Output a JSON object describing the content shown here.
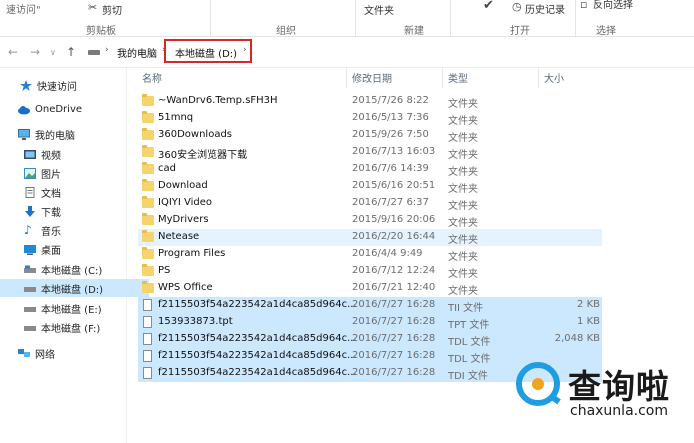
{
  "ribbon": {
    "copy_path": "速访问\"",
    "cut": "剪切",
    "clipboard_group": "剪贴板",
    "organize_group": "组织",
    "folder_label": "文件夹",
    "new_group": "新建",
    "open_group": "打开",
    "history": "历史记录",
    "invert_selection": "反向选择",
    "select_group": "选择"
  },
  "address": {
    "crumbs": [
      "我的电脑",
      "本地磁盘 (D:)"
    ],
    "separator": "›"
  },
  "sidebar": {
    "items": [
      {
        "label": "快速访问",
        "icon": "star-icon"
      },
      {
        "label": "OneDrive",
        "icon": "cloud-icon"
      },
      {
        "label": "我的电脑",
        "icon": "computer-icon"
      },
      {
        "label": "视频",
        "icon": "video-icon"
      },
      {
        "label": "图片",
        "icon": "picture-icon"
      },
      {
        "label": "文档",
        "icon": "document-icon"
      },
      {
        "label": "下载",
        "icon": "download-icon"
      },
      {
        "label": "音乐",
        "icon": "music-icon"
      },
      {
        "label": "桌面",
        "icon": "desktop-icon"
      },
      {
        "label": "本地磁盘 (C:)",
        "icon": "drive-icon"
      },
      {
        "label": "本地磁盘 (D:)",
        "icon": "drive-icon"
      },
      {
        "label": "本地磁盘 (E:)",
        "icon": "drive-icon"
      },
      {
        "label": "本地磁盘 (F:)",
        "icon": "drive-icon"
      },
      {
        "label": "网络",
        "icon": "network-icon"
      }
    ]
  },
  "columns": {
    "name": "名称",
    "modified": "修改日期",
    "type": "类型",
    "size": "大小"
  },
  "files": [
    {
      "name": "~WanDrv6.Temp.sFH3H",
      "modified": "2015/7/26 8:22",
      "type": "文件夹",
      "size": ""
    },
    {
      "name": "51mnq",
      "modified": "2016/5/13 7:36",
      "type": "文件夹",
      "size": ""
    },
    {
      "name": "360Downloads",
      "modified": "2015/9/26 7:50",
      "type": "文件夹",
      "size": ""
    },
    {
      "name": "360安全浏览器下载",
      "modified": "2016/7/13 16:03",
      "type": "文件夹",
      "size": ""
    },
    {
      "name": "cad",
      "modified": "2016/7/6 14:39",
      "type": "文件夹",
      "size": ""
    },
    {
      "name": "Download",
      "modified": "2015/6/16 20:51",
      "type": "文件夹",
      "size": ""
    },
    {
      "name": "IQIYI Video",
      "modified": "2016/7/27 6:37",
      "type": "文件夹",
      "size": ""
    },
    {
      "name": "MyDrivers",
      "modified": "2015/9/16 20:06",
      "type": "文件夹",
      "size": ""
    },
    {
      "name": "Netease",
      "modified": "2016/2/20 16:44",
      "type": "文件夹",
      "size": ""
    },
    {
      "name": "Program Files",
      "modified": "2016/4/4 9:49",
      "type": "文件夹",
      "size": ""
    },
    {
      "name": "PS",
      "modified": "2016/7/12 12:24",
      "type": "文件夹",
      "size": ""
    },
    {
      "name": "WPS Office",
      "modified": "2016/7/21 12:40",
      "type": "文件夹",
      "size": ""
    },
    {
      "name": "f2115503f54a223542a1d4ca85d964c...",
      "modified": "2016/7/27 16:28",
      "type": "TII 文件",
      "size": "2 KB"
    },
    {
      "name": "153933873.tpt",
      "modified": "2016/7/27 16:28",
      "type": "TPT 文件",
      "size": "1 KB"
    },
    {
      "name": "f2115503f54a223542a1d4ca85d964c...",
      "modified": "2016/7/27 16:28",
      "type": "TDL 文件",
      "size": "2,048 KB"
    },
    {
      "name": "f2115503f54a223542a1d4ca85d964c...",
      "modified": "2016/7/27 16:28",
      "type": "TDL 文件",
      "size": ""
    },
    {
      "name": "f2115503f54a223542a1d4ca85d964c...",
      "modified": "2016/7/27 16:28",
      "type": "TDI 文件",
      "size": ""
    }
  ],
  "watermark": {
    "title": "查询啦",
    "url": "chaxunla.com"
  },
  "colors": {
    "selection": "#cce8ff",
    "hover": "#e5f3ff",
    "folder": "#f5d46e",
    "highlight_box": "#d62828",
    "brand_blue": "#1e9de0",
    "brand_orange": "#f3a31b"
  }
}
